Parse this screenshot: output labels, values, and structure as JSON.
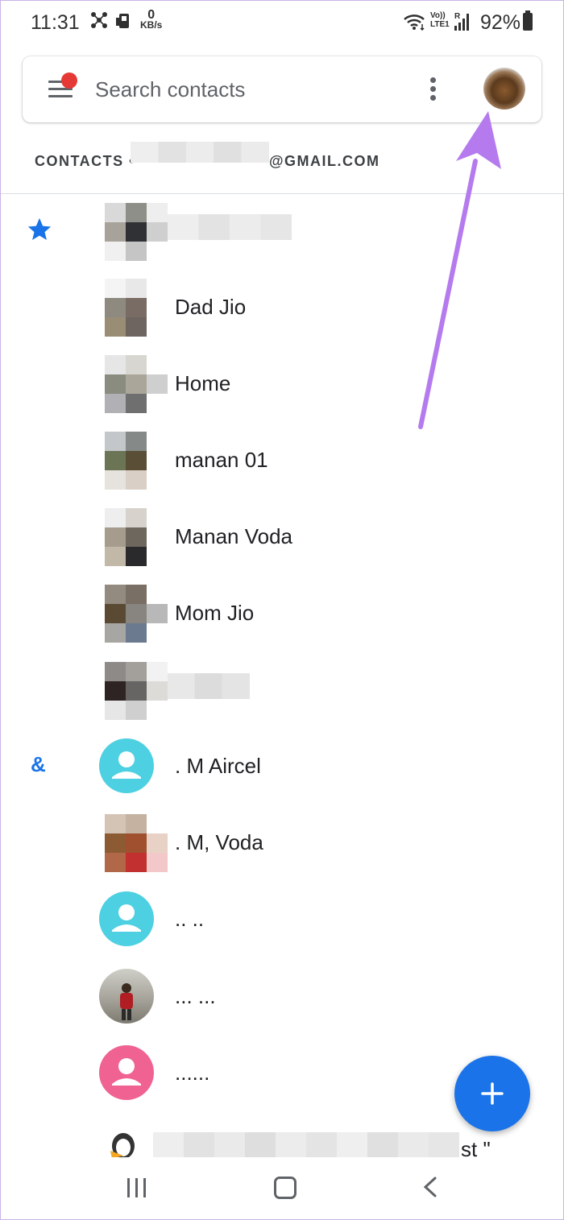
{
  "status_bar": {
    "time": "11:31",
    "net_speed_value": "0",
    "net_speed_unit": "KB/s",
    "volte_top": "Vo))",
    "volte_bottom": "LTE1",
    "signal_label": "R",
    "battery": "92%"
  },
  "search": {
    "placeholder": "Search contacts",
    "menu_icon": "hamburger-menu-icon",
    "more_icon": "more-vert-icon",
    "account_avatar_icon": "account-avatar"
  },
  "account": {
    "label": "CONTACTS •",
    "domain": "@GMAIL.COM"
  },
  "sections": {
    "starred_icon": "star-icon",
    "symbol_header": "&"
  },
  "contacts": [
    {
      "name": "",
      "avatar": "blurred-photo"
    },
    {
      "name": "Dad Jio",
      "avatar": "blurred-photo"
    },
    {
      "name": "Home",
      "avatar": "blurred-photo"
    },
    {
      "name": "manan 01",
      "avatar": "blurred-photo"
    },
    {
      "name": "Manan Voda",
      "avatar": "blurred-photo"
    },
    {
      "name": "Mom Jio",
      "avatar": "blurred-photo"
    },
    {
      "name": "",
      "avatar": "blurred-photo"
    },
    {
      "name": ". M Aircel",
      "avatar": "default-person-icon",
      "avatar_color": "#4dd0e1"
    },
    {
      "name": ". M, Voda",
      "avatar": "blurred-photo"
    },
    {
      "name": ".. ..",
      "avatar": "default-person-icon",
      "avatar_color": "#4dd0e1"
    },
    {
      "name": "... ...",
      "avatar": "photo"
    },
    {
      "name": "......",
      "avatar": "default-person-icon",
      "avatar_color": "#f06292"
    },
    {
      "name": "st \"",
      "avatar": "cartoon-photo"
    }
  ],
  "fab": {
    "icon": "plus-icon",
    "color": "#1a73e8"
  },
  "nav_bar": {
    "recent_icon": "recent-apps-icon",
    "home_icon": "home-icon",
    "back_icon": "back-icon"
  },
  "annotation": {
    "color": "#b57bee"
  }
}
